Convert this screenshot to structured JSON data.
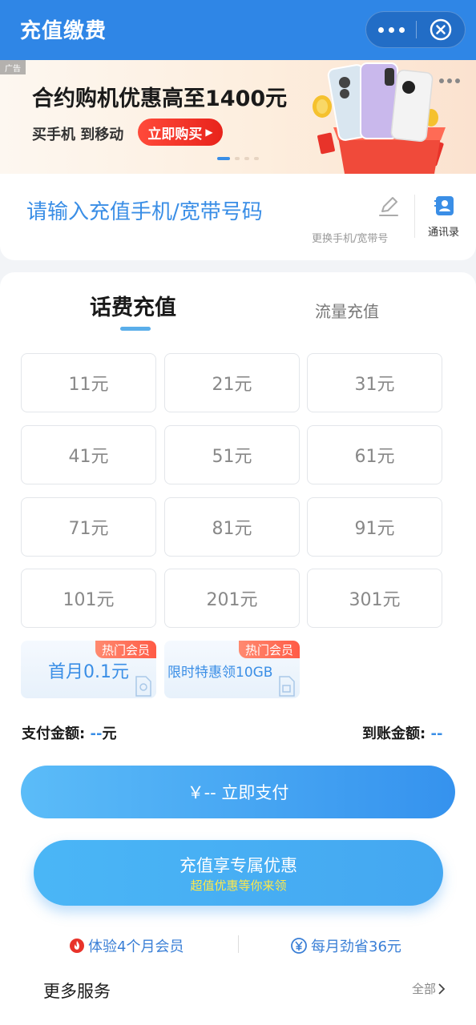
{
  "header": {
    "title": "充值缴费"
  },
  "banner": {
    "ad_tag": "广告",
    "title": "合约购机优惠高至1400元",
    "subtitle": "买手机 到移动",
    "button": "立即购买"
  },
  "input": {
    "placeholder": "请输入充值手机/宽带号码",
    "change_label": "更换手机/宽带号",
    "contacts_label": "通讯录"
  },
  "tabs": [
    {
      "label": "话费充值",
      "active": true
    },
    {
      "label": "流量充值",
      "active": false
    }
  ],
  "amounts": [
    "11元",
    "21元",
    "31元",
    "41元",
    "51元",
    "61元",
    "71元",
    "81元",
    "91元",
    "101元",
    "201元",
    "301元"
  ],
  "promos": [
    {
      "badge": "热门会员",
      "text": "首月0.1元"
    },
    {
      "badge": "热门会员",
      "text": "限时特惠领10GB"
    }
  ],
  "summary": {
    "pay_label": "支付金额:",
    "pay_value": "--",
    "pay_unit": "元",
    "recv_label": "到账金额:",
    "recv_value": "--"
  },
  "pay_button": "￥-- 立即支付",
  "promo_button": {
    "title": "充值享专属优惠",
    "subtitle": "超值优惠等你来领"
  },
  "benefits": [
    {
      "text": "体验4个月会员"
    },
    {
      "text": "每月劲省36元"
    }
  ],
  "more": {
    "title": "更多服务",
    "all": "全部"
  },
  "colors": {
    "brand": "#2f86e6",
    "accent": "#3a8ee6",
    "hot": "#ff5b46"
  }
}
